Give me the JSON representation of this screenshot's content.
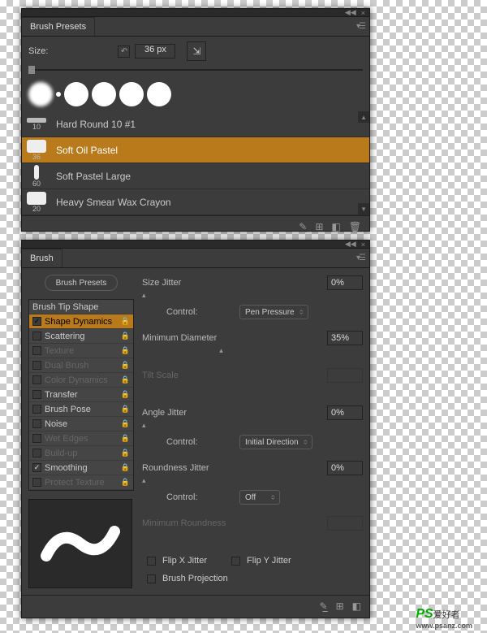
{
  "panel1": {
    "title": "Brush Presets",
    "size_label": "Size:",
    "size_value": "36 px",
    "brushes": [
      {
        "size": "10",
        "name": "Hard Round 10 #1"
      },
      {
        "size": "36",
        "name": "Soft Oil Pastel"
      },
      {
        "size": "60",
        "name": "Soft Pastel Large"
      },
      {
        "size": "20",
        "name": "Heavy Smear Wax Crayon"
      }
    ]
  },
  "panel2": {
    "title": "Brush",
    "presets_btn": "Brush Presets",
    "options": [
      {
        "label": "Brush Tip Shape",
        "checked": null,
        "disabled": false
      },
      {
        "label": "Shape Dynamics",
        "checked": true,
        "disabled": false,
        "selected": true
      },
      {
        "label": "Scattering",
        "checked": false,
        "disabled": false
      },
      {
        "label": "Texture",
        "checked": false,
        "disabled": true
      },
      {
        "label": "Dual Brush",
        "checked": false,
        "disabled": true
      },
      {
        "label": "Color Dynamics",
        "checked": false,
        "disabled": true
      },
      {
        "label": "Transfer",
        "checked": false,
        "disabled": false
      },
      {
        "label": "Brush Pose",
        "checked": false,
        "disabled": false
      },
      {
        "label": "Noise",
        "checked": false,
        "disabled": false
      },
      {
        "label": "Wet Edges",
        "checked": false,
        "disabled": true
      },
      {
        "label": "Build-up",
        "checked": false,
        "disabled": true
      },
      {
        "label": "Smoothing",
        "checked": true,
        "disabled": false
      },
      {
        "label": "Protect Texture",
        "checked": false,
        "disabled": true
      }
    ],
    "size_jitter_label": "Size Jitter",
    "size_jitter_value": "0%",
    "control_label": "Control:",
    "control1_value": "Pen Pressure",
    "min_diam_label": "Minimum Diameter",
    "min_diam_value": "35%",
    "tilt_scale_label": "Tilt Scale",
    "angle_jitter_label": "Angle Jitter",
    "angle_jitter_value": "0%",
    "control2_value": "Initial Direction",
    "roundness_label": "Roundness Jitter",
    "roundness_value": "0%",
    "control3_value": "Off",
    "min_round_label": "Minimum Roundness",
    "flipx_label": "Flip X Jitter",
    "flipy_label": "Flip Y Jitter",
    "projection_label": "Brush Projection"
  },
  "watermark": {
    "logo": "PS",
    "text": "爱好者",
    "url": "www.psanz.com"
  }
}
